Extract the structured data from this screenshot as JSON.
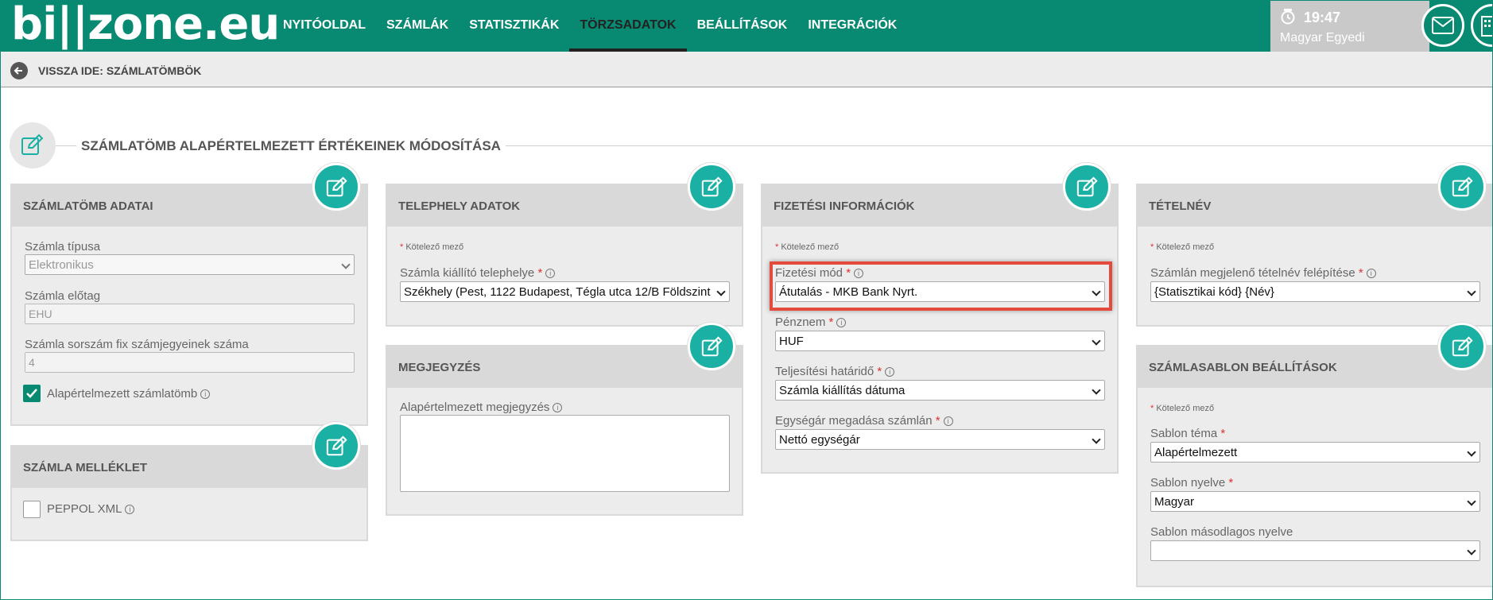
{
  "header": {
    "logo": "bi||zone.eu",
    "nav": [
      "NYITÓOLDAL",
      "SZÁMLÁK",
      "STATISZTIKÁK",
      "TÖRZSADATOK",
      "BEÁLLÍTÁSOK",
      "INTEGRÁCIÓK"
    ],
    "active_nav": "TÖRZSADATOK",
    "time": "19:47",
    "user": "Magyar Egyedi"
  },
  "back_label": "VISSZA IDE: SZÁMLATÖMBÖK",
  "page_title": "SZÁMLATÖMB ALAPÉRTELMEZETT ÉRTÉKEINEK MÓDOSÍTÁSA",
  "required_note": "Kötelező mező",
  "cards": {
    "szamlatomb": {
      "title": "SZÁMLATÖMB ADATAI",
      "type_label": "Számla típusa",
      "type_value": "Elektronikus",
      "prefix_label": "Számla előtag",
      "prefix_value": "EHU",
      "digits_label": "Számla sorszám fix számjegyeinek száma",
      "digits_value": "4",
      "default_label": "Alapértelmezett számlatömb"
    },
    "melleklet": {
      "title": "SZÁMLA MELLÉKLET",
      "peppol_label": "PEPPOL XML"
    },
    "telephely": {
      "title": "TELEPHELY ADATOK",
      "site_label": "Számla kiállító telephelye",
      "site_value": "Székhely (Pest, 1122 Budapest, Tégla utca 12/B Földszint"
    },
    "megjegyzes": {
      "title": "MEGJEGYZÉS",
      "note_label": "Alapértelmezett megjegyzés"
    },
    "fizetes": {
      "title": "FIZETÉSI INFORMÁCIÓK",
      "method_label": "Fizetési mód",
      "method_value": "Átutalás - MKB Bank Nyrt.",
      "currency_label": "Pénznem",
      "currency_value": "HUF",
      "deadline_label": "Teljesítési határidő",
      "deadline_value": "Számla kiállítás dátuma",
      "unitprice_label": "Egységár megadása számlán",
      "unitprice_value": "Nettó egységár"
    },
    "tetelnev": {
      "title": "TÉTELNÉV",
      "structure_label": "Számlán megjelenő tételnév felépítése",
      "structure_value": "{Statisztikai kód} {Név}"
    },
    "sablon": {
      "title": "SZÁMLASABLON BEÁLLÍTÁSOK",
      "theme_label": "Sablon téma",
      "theme_value": "Alapértelmezett",
      "lang_label": "Sablon nyelve",
      "lang_value": "Magyar",
      "lang2_label": "Sablon másodlagos nyelve",
      "lang2_value": ""
    }
  },
  "colors": {
    "brand": "#088a72",
    "accent": "#1bb0a4",
    "highlight": "#e34b3c"
  }
}
